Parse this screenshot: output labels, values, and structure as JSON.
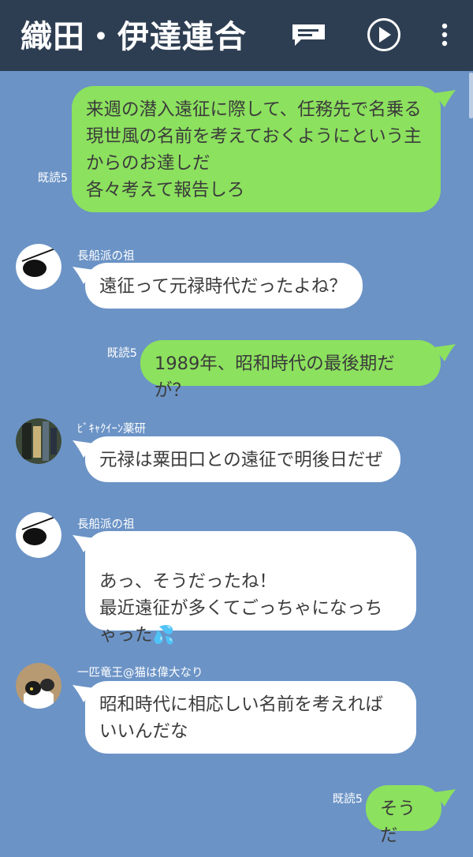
{
  "header": {
    "title": "織田・伊達連合",
    "icons": [
      "note-icon",
      "play-icon",
      "more-vertical-icon"
    ]
  },
  "messages": [
    {
      "from": "me",
      "read": "既読5",
      "text": "来週の潜入遠征に際して、任務先で名乗る\n現世風の名前を考えておくようにという主\nからのお達しだ\n各々考えて報告しろ"
    },
    {
      "from": "other",
      "sender": "長船派の祖",
      "avatar": "eyepatch-avatar",
      "text": "遠征って元禄時代だったよね？"
    },
    {
      "from": "me",
      "read": "既読5",
      "text": "1989年、昭和時代の最後期だが？"
    },
    {
      "from": "other",
      "sender": "ﾋﾞｷｬｸｲｰﾝ薬研",
      "avatar": "photo-avatar",
      "text": "元禄は粟田口との遠征で明後日だぜ"
    },
    {
      "from": "other",
      "sender": "長船派の祖",
      "avatar": "eyepatch-avatar",
      "text": "あっ、そうだったね！\n最近遠征が多くてごっちゃになっち\nゃった",
      "emoji": "💦"
    },
    {
      "from": "other",
      "sender": "一匹竜王@猫は偉大なり",
      "avatar": "cat-photo-avatar",
      "text": "昭和時代に相応しい名前を考えれば\nいいんだな"
    },
    {
      "from": "me",
      "read": "既読5",
      "text": "そうだ"
    }
  ],
  "colors": {
    "header_bg": "#2e3e52",
    "chat_bg": "#6b93c6",
    "my_bubble": "#8ce15e",
    "other_bubble": "#ffffff"
  }
}
